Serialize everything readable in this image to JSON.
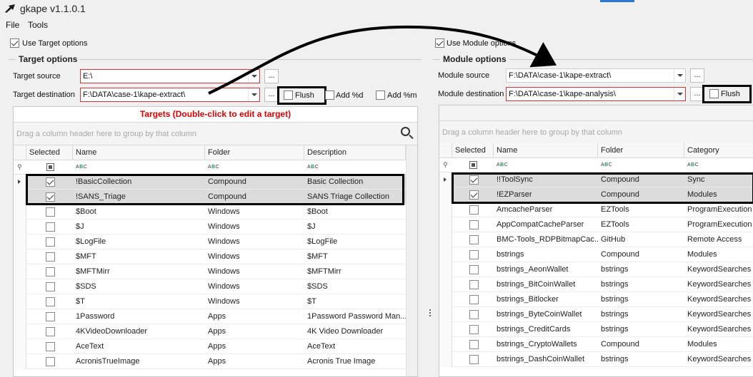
{
  "app": {
    "title": "gkape v1.1.0.1",
    "icon": "kape-app-icon"
  },
  "menu": [
    "File",
    "Tools"
  ],
  "target": {
    "use_label": "Use Target options",
    "use_checked": true,
    "group_title": "Target options",
    "source_label": "Target source",
    "source_value": "E:\\",
    "dest_label": "Target destination",
    "dest_value": "F:\\DATA\\case-1\\kape-extract\\",
    "flush_label": "Flush",
    "add_d_label": "Add %d",
    "add_m_label": "Add %m",
    "grid_caption": "Targets (Double-click to edit a target)",
    "group_hint": "Drag a column header here to group by that column",
    "columns": [
      "Selected",
      "Name",
      "Folder",
      "Description"
    ],
    "rows": [
      {
        "checked": true,
        "name": "!BasicCollection",
        "folder": "Compound",
        "desc": "Basic Collection"
      },
      {
        "checked": true,
        "name": "!SANS_Triage",
        "folder": "Compound",
        "desc": "SANS Triage Collection"
      },
      {
        "checked": false,
        "name": "$Boot",
        "folder": "Windows",
        "desc": "$Boot"
      },
      {
        "checked": false,
        "name": "$J",
        "folder": "Windows",
        "desc": "$J"
      },
      {
        "checked": false,
        "name": "$LogFile",
        "folder": "Windows",
        "desc": "$LogFile"
      },
      {
        "checked": false,
        "name": "$MFT",
        "folder": "Windows",
        "desc": "$MFT"
      },
      {
        "checked": false,
        "name": "$MFTMirr",
        "folder": "Windows",
        "desc": "$MFTMirr"
      },
      {
        "checked": false,
        "name": "$SDS",
        "folder": "Windows",
        "desc": "$SDS"
      },
      {
        "checked": false,
        "name": "$T",
        "folder": "Windows",
        "desc": "$T"
      },
      {
        "checked": false,
        "name": "1Password",
        "folder": "Apps",
        "desc": "1Password Password Man..."
      },
      {
        "checked": false,
        "name": "4KVideoDownloader",
        "folder": "Apps",
        "desc": "4K Video Downloader"
      },
      {
        "checked": false,
        "name": "AceText",
        "folder": "Apps",
        "desc": "AceText"
      },
      {
        "checked": false,
        "name": "AcronisTrueImage",
        "folder": "Apps",
        "desc": "Acronis True Image"
      }
    ]
  },
  "module": {
    "use_label": "Use Module options",
    "use_checked": true,
    "group_title": "Module options",
    "source_label": "Module source",
    "source_value": "F:\\DATA\\case-1\\kape-extract\\",
    "dest_label": "Module destination",
    "dest_value": "F:\\DATA\\case-1\\kape-analysis\\",
    "flush_label": "Flush",
    "group_hint": "Drag a column header here to group by that column",
    "columns": [
      "Selected",
      "Name",
      "Folder",
      "Category"
    ],
    "rows": [
      {
        "checked": true,
        "name": "!!ToolSync",
        "folder": "Compound",
        "cat": "Sync"
      },
      {
        "checked": true,
        "name": "!EZParser",
        "folder": "Compound",
        "cat": "Modules"
      },
      {
        "checked": false,
        "name": "AmcacheParser",
        "folder": "EZTools",
        "cat": "ProgramExecution"
      },
      {
        "checked": false,
        "name": "AppCompatCacheParser",
        "folder": "EZTools",
        "cat": "ProgramExecution"
      },
      {
        "checked": false,
        "name": "BMC-Tools_RDPBitmapCac...",
        "folder": "GitHub",
        "cat": "Remote Access"
      },
      {
        "checked": false,
        "name": "bstrings",
        "folder": "Compound",
        "cat": "Modules"
      },
      {
        "checked": false,
        "name": "bstrings_AeonWallet",
        "folder": "bstrings",
        "cat": "KeywordSearches"
      },
      {
        "checked": false,
        "name": "bstrings_BitCoinWallet",
        "folder": "bstrings",
        "cat": "KeywordSearches"
      },
      {
        "checked": false,
        "name": "bstrings_Bitlocker",
        "folder": "bstrings",
        "cat": "KeywordSearches"
      },
      {
        "checked": false,
        "name": "bstrings_ByteCoinWallet",
        "folder": "bstrings",
        "cat": "KeywordSearches"
      },
      {
        "checked": false,
        "name": "bstrings_CreditCards",
        "folder": "bstrings",
        "cat": "KeywordSearches"
      },
      {
        "checked": false,
        "name": "bstrings_CryptoWallets",
        "folder": "Compound",
        "cat": "Modules"
      },
      {
        "checked": false,
        "name": "bstrings_DashCoinWallet",
        "folder": "bstrings",
        "cat": "KeywordSearches"
      }
    ]
  }
}
